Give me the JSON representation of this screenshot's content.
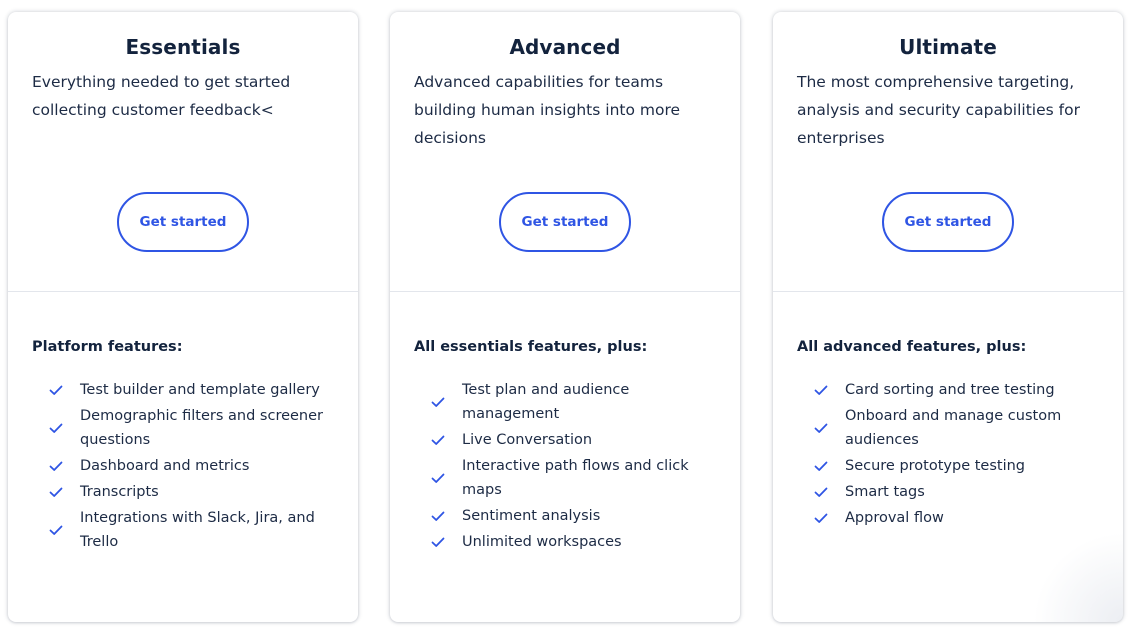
{
  "colors": {
    "accent": "#2f55e4",
    "heading": "#13233d",
    "text": "#1d2b45",
    "divider": "#e3e6ec"
  },
  "plans": [
    {
      "title": "Essentials",
      "description": "Everything needed to get started collecting customer feedback<",
      "cta_label": "Get started",
      "features_heading": "Platform features:",
      "features": [
        "Test builder and template gallery",
        "Demographic filters and screener questions",
        "Dashboard and metrics",
        "Transcripts",
        "Integrations with Slack, Jira, and Trello"
      ]
    },
    {
      "title": "Advanced",
      "description": "Advanced capabilities for teams building human insights into more decisions",
      "cta_label": "Get started",
      "features_heading": "All essentials features, plus:",
      "features": [
        "Test plan and audience management",
        "Live Conversation",
        "Interactive path flows and click maps",
        "Sentiment analysis",
        "Unlimited workspaces"
      ]
    },
    {
      "title": "Ultimate",
      "description": "The most comprehensive targeting, analysis and security capabilities for enterprises",
      "cta_label": "Get started",
      "features_heading": "All advanced features, plus:",
      "features": [
        "Card sorting and tree testing",
        "Onboard and manage custom audiences",
        "Secure prototype testing",
        "Smart tags",
        "Approval flow"
      ]
    }
  ],
  "icons": {
    "feature_check": "check-icon"
  }
}
